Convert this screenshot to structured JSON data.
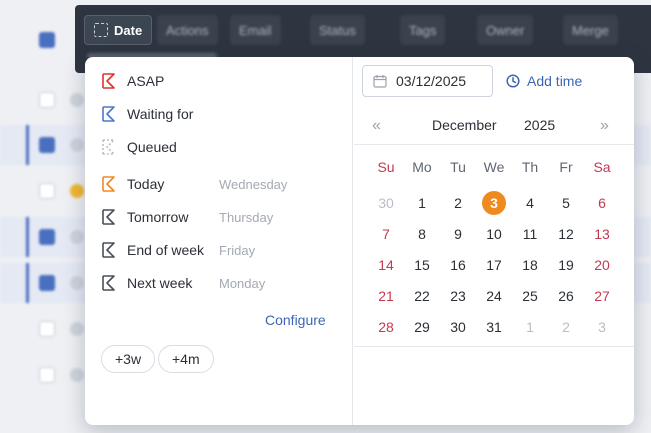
{
  "toolbar": {
    "buttons": [
      {
        "label": "Date",
        "icon": "queued-flag-icon"
      },
      {
        "label": "Actions",
        "icon": ""
      },
      {
        "label": "Email",
        "icon": "email-icon"
      },
      {
        "label": "Status",
        "icon": "status-icon"
      },
      {
        "label": "Tags",
        "icon": "tag-icon"
      },
      {
        "label": "Owner",
        "icon": "user-icon"
      },
      {
        "label": "Merge",
        "icon": "merge-icon"
      }
    ]
  },
  "options": [
    {
      "label": "ASAP",
      "hint": "",
      "color": "#d9352b",
      "style": "solid"
    },
    {
      "label": "Waiting for",
      "hint": "",
      "color": "#4c78c8",
      "style": "solid"
    },
    {
      "label": "Queued",
      "hint": "",
      "color": "#b9bec7",
      "style": "dashed"
    },
    {
      "label": "Today",
      "hint": "Wednesday",
      "color": "#ef8a20",
      "style": "solid"
    },
    {
      "label": "Tomorrow",
      "hint": "Thursday",
      "color": "#4a4f58",
      "style": "solid"
    },
    {
      "label": "End of week",
      "hint": "Friday",
      "color": "#4a4f58",
      "style": "solid"
    },
    {
      "label": "Next week",
      "hint": "Monday",
      "color": "#4a4f58",
      "style": "solid"
    }
  ],
  "configure_label": "Configure",
  "chips": [
    "+3w",
    "+4m"
  ],
  "date_input": {
    "value": "03/12/2025"
  },
  "add_time_label": "Add time",
  "calendar": {
    "prev_label": "«",
    "next_label": "»",
    "month": "December",
    "year": "2025",
    "weekdays": [
      "Su",
      "Mo",
      "Tu",
      "We",
      "Th",
      "Fr",
      "Sa"
    ],
    "weeks": [
      [
        "30",
        "1",
        "2",
        "3",
        "4",
        "5",
        "6"
      ],
      [
        "7",
        "8",
        "9",
        "10",
        "11",
        "12",
        "13"
      ],
      [
        "14",
        "15",
        "16",
        "17",
        "18",
        "19",
        "20"
      ],
      [
        "21",
        "22",
        "23",
        "24",
        "25",
        "26",
        "27"
      ],
      [
        "28",
        "29",
        "30",
        "31",
        "1",
        "2",
        "3"
      ]
    ],
    "selected_day": "3"
  },
  "colors": {
    "accent": "#3b66b5",
    "today": "#ef8a20",
    "weekend": "#c23a4f",
    "toolbar": "#2e3540"
  }
}
